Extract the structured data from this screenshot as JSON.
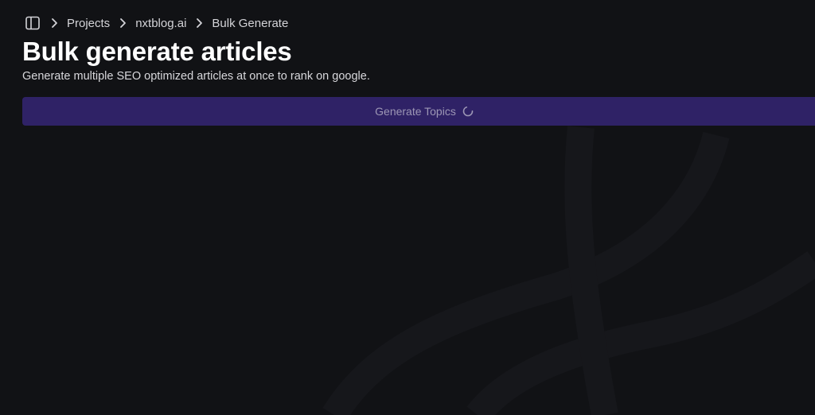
{
  "breadcrumb": {
    "items": [
      {
        "label": "Projects"
      },
      {
        "label": "nxtblog.ai"
      },
      {
        "label": "Bulk Generate"
      }
    ]
  },
  "header": {
    "title": "Bulk generate articles",
    "subtitle": "Generate multiple SEO optimized articles at once to rank on google."
  },
  "actions": {
    "generate_topics_label": "Generate Topics",
    "loading": true
  },
  "icons": {
    "sidebar_toggle": "sidebar-panel-icon",
    "separator": "chevron-right-icon",
    "loading": "spinner-icon"
  },
  "colors": {
    "background": "#111215",
    "button_bg": "#2f2266",
    "button_text": "#9d97b5",
    "title": "#ffffff",
    "text": "#d4d4d8"
  }
}
